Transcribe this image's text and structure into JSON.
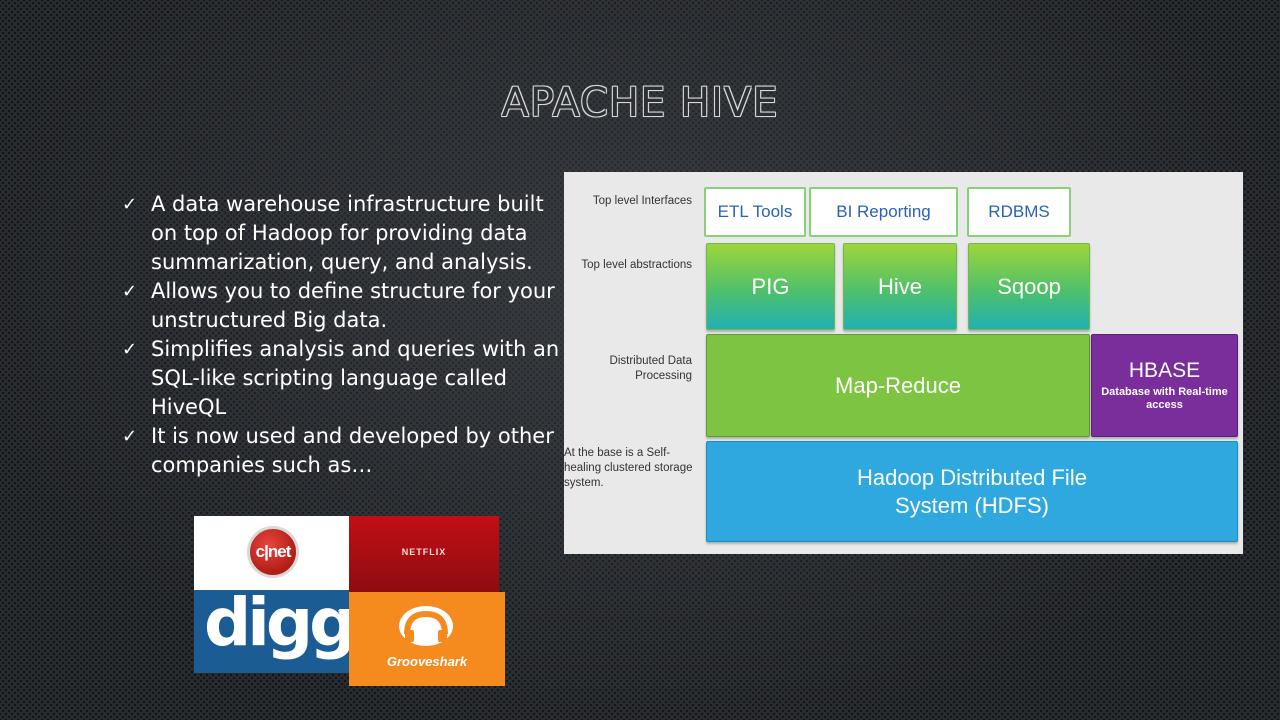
{
  "slide": {
    "title": "Apache Hive",
    "bullets": [
      "A data warehouse infrastructure built on top of Hadoop for providing data summarization, query, and analysis.",
      "Allows you to define structure for your unstructured Big data.",
      "Simplifies analysis and queries with an SQL-like scripting language called HiveQL",
      "It is now used and developed by other companies such as…"
    ]
  },
  "logos": {
    "cnet": "c|net",
    "netflix": "NETFLIX",
    "digg": "digg",
    "digg_tm": "™",
    "grooveshark": "Grooveshark"
  },
  "diagram": {
    "labels": {
      "interfaces": "Top level Interfaces",
      "abstractions": "Top level abstractions",
      "processing": "Distributed Data Processing",
      "base": "At the base is a Self-healing clustered storage system."
    },
    "interfaces": [
      "ETL Tools",
      "BI Reporting",
      "RDBMS"
    ],
    "abstractions": [
      "PIG",
      "Hive",
      "Sqoop"
    ],
    "processing": "Map-Reduce",
    "hbase": {
      "title": "HBASE",
      "subtitle": "Database with Real-time access"
    },
    "storage": "Hadoop Distributed File System (HDFS)"
  },
  "colors": {
    "title_outline": "#d8dadd",
    "interface_border": "#8ad07a",
    "interface_text": "#2a62b8",
    "mapreduce": "#7ec443",
    "hbase": "#7a2e9c",
    "hdfs": "#2ea8df",
    "grooveshark": "#f58a1f",
    "digg": "#1a5c93",
    "netflix": "#c10f15"
  }
}
